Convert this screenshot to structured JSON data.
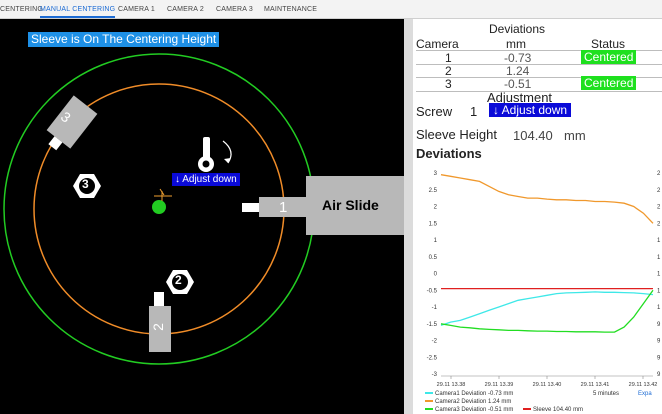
{
  "tabs": [
    {
      "label": "CENTERING",
      "active": false
    },
    {
      "label": "MANUAL CENTERING",
      "active": true
    },
    {
      "label": "CAMERA 1",
      "active": false
    },
    {
      "label": "CAMERA 2",
      "active": false
    },
    {
      "label": "CAMERA 3",
      "active": false
    },
    {
      "label": "MAINTENANCE",
      "active": false
    }
  ],
  "view": {
    "status_banner": "Sleeve is On The Centering Height",
    "adjust_tag": "↓ Adjust down",
    "air_slide_label": "Air Slide",
    "camera_labels": [
      "1",
      "2",
      "3"
    ],
    "screw_labels": [
      "2",
      "3"
    ]
  },
  "deviations_table": {
    "title": "Deviations",
    "headers": [
      "Camera",
      "mm",
      "Status"
    ],
    "rows": [
      {
        "camera": "1",
        "mm": "-0.73",
        "status": "Centered"
      },
      {
        "camera": "2",
        "mm": "1.24",
        "status": ""
      },
      {
        "camera": "3",
        "mm": "-0.51",
        "status": "Centered"
      }
    ]
  },
  "adjustment": {
    "title": "Adjustment",
    "screw_label": "Screw",
    "screw_number": "1",
    "action": "↓ Adjust down"
  },
  "sleeve": {
    "label": "Sleeve Height",
    "value": "104.40",
    "unit": "mm"
  },
  "colors": {
    "camera1": "#3ee8e8",
    "camera2": "#f0982c",
    "camera3": "#22dd22",
    "sleeve": "#e02020",
    "centered": "#1ee01e",
    "adjust": "#0a0ad8"
  },
  "chart_data": {
    "type": "line",
    "title": "Deviations",
    "x_ticks": [
      "29.11 13.38",
      "29.11 13.39",
      "29.11 13.40",
      "29.11 13.41",
      "29.11 13.42"
    ],
    "ylim": [
      -3,
      3
    ],
    "y_ticks": [
      "3",
      "2.5",
      "2",
      "1.5",
      "1",
      "0.5",
      "0",
      "-0.5",
      "-1",
      "-1.5",
      "-2",
      "-2.5",
      "-3"
    ],
    "right_axis_ticks": [
      "2",
      "2",
      "2",
      "2",
      "1",
      "1",
      "1",
      "1",
      "1",
      "9",
      "9",
      "9",
      "9"
    ],
    "time_window": "5 minutes",
    "expand_label": "Expa",
    "x": [
      0,
      0.2,
      0.4,
      0.6,
      0.8,
      1.0,
      1.2,
      1.4,
      1.6,
      1.8,
      2.0,
      2.2,
      2.4,
      2.6,
      2.8,
      3.0,
      3.2,
      3.4,
      3.6,
      3.8,
      4.0,
      4.2,
      4.4
    ],
    "series": [
      {
        "name": "Camera1 Deviation",
        "legend_value": "-0.73",
        "unit": "mm",
        "values": [
          -1.55,
          -1.45,
          -1.4,
          -1.3,
          -1.2,
          -1.1,
          -1.0,
          -0.9,
          -0.8,
          -0.75,
          -0.7,
          -0.65,
          -0.6,
          -0.58,
          -0.57,
          -0.56,
          -0.55,
          -0.56,
          -0.56,
          -0.57,
          -0.58,
          -0.6,
          -0.63
        ]
      },
      {
        "name": "Camera2 Deviation",
        "legend_value": "1.24",
        "unit": "mm",
        "values": [
          2.95,
          2.9,
          2.85,
          2.8,
          2.75,
          2.6,
          2.45,
          2.35,
          2.3,
          2.25,
          2.25,
          2.22,
          2.2,
          2.2,
          2.18,
          2.18,
          2.15,
          2.15,
          2.13,
          2.1,
          2.0,
          1.8,
          1.5
        ]
      },
      {
        "name": "Camera3 Deviation",
        "legend_value": "-0.51",
        "unit": "mm",
        "values": [
          -1.5,
          -1.55,
          -1.6,
          -1.62,
          -1.65,
          -1.67,
          -1.68,
          -1.7,
          -1.7,
          -1.71,
          -1.72,
          -1.72,
          -1.73,
          -1.73,
          -1.74,
          -1.74,
          -1.74,
          -1.75,
          -1.75,
          -1.6,
          -1.3,
          -0.9,
          -0.5
        ]
      },
      {
        "name": "Sleeve",
        "legend_value": "104.40",
        "unit": "mm",
        "values": [
          -0.45,
          -0.45,
          -0.45,
          -0.45,
          -0.45,
          -0.45,
          -0.45,
          -0.45,
          -0.45,
          -0.45,
          -0.45,
          -0.45,
          -0.45,
          -0.45,
          -0.45,
          -0.45,
          -0.45,
          -0.45,
          -0.45,
          -0.45,
          -0.45,
          -0.45,
          -0.45
        ]
      }
    ],
    "legend_position": "bottom",
    "grid": false
  }
}
